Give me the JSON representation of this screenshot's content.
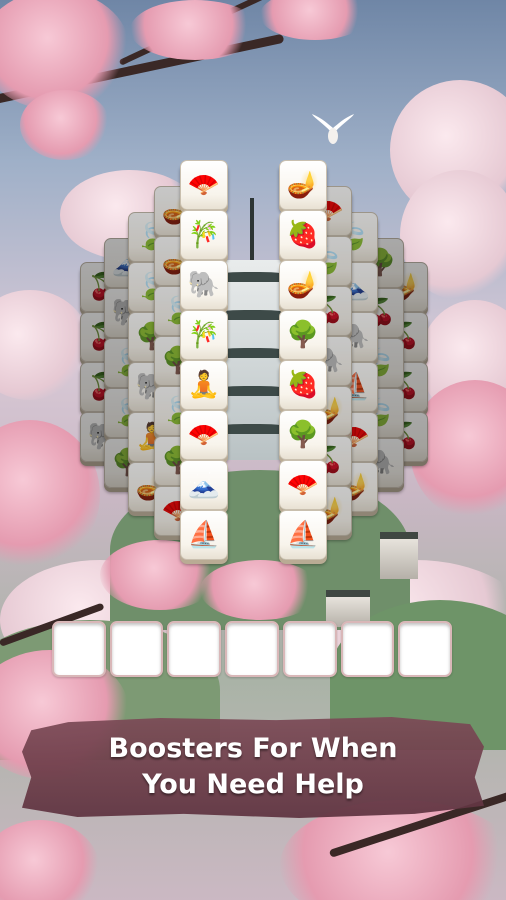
{
  "banner": {
    "line1": "Boosters For When",
    "line2": "You Need Help"
  },
  "tray": {
    "slot_count": 7
  },
  "tile_icons": {
    "fan": "🪭",
    "bamboo": "🎋",
    "elephant": "🐘",
    "buddha": "🧘",
    "pagoda-hat": "🟢",
    "ship": "⛵",
    "dragon-fruit": "🍓",
    "lamp": "🪔",
    "bonsai": "🌳",
    "leaf": "🍃",
    "red-berry": "🍒"
  },
  "colors": {
    "banner": "#6c3c48",
    "tile_face": "#fbf8f1",
    "slot_border": "#d9b7b8"
  }
}
